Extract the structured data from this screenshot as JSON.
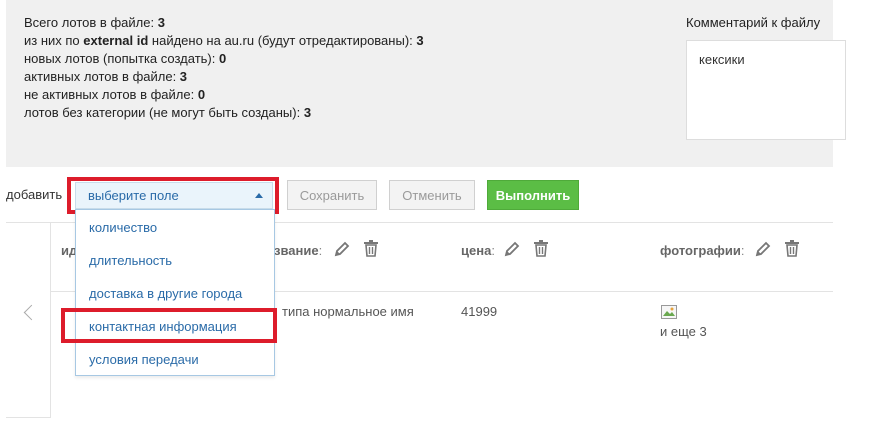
{
  "stats": {
    "total_label": "Всего лотов в файле: ",
    "total_value": "3",
    "found_prefix": "из них по ",
    "found_bold": "external id",
    "found_suffix": " найдено на au.ru (будут отредактированы): ",
    "found_value": "3",
    "new_label": "новых лотов (попытка создать): ",
    "new_value": "0",
    "active_label": "активных лотов в файле: ",
    "active_value": "3",
    "inactive_label": "не активных лотов в файле: ",
    "inactive_value": "0",
    "nocat_label": "лотов без категории (не могут быть созданы): ",
    "nocat_value": "3"
  },
  "comment": {
    "label": "Комментарий к файлу",
    "value": "кексики"
  },
  "toolbar": {
    "add_label": "добавить",
    "select_value": "выберите поле",
    "save_label": "Сохранить",
    "cancel_label": "Отменить",
    "run_label": "Выполнить"
  },
  "dropdown": {
    "options": [
      "количество",
      "длительность",
      "доставка в другие города",
      "контактная информация",
      "условия передачи"
    ],
    "highlighted_option": "контактная информация"
  },
  "columns": {
    "id_label": "ид",
    "name_label": "звание",
    "price_label": "цена",
    "photos_label": "фотографии",
    "colon": ":"
  },
  "row": {
    "name_fragment": "типа нормальное имя",
    "price": "41999",
    "photos_more": "и еще 3"
  },
  "colors": {
    "highlight": "#dd1c2b",
    "accent_blue": "#2a6ba8",
    "run_green": "#5bbd45",
    "panel_bg": "#f0f0f0"
  },
  "icons": [
    "pencil-icon",
    "trash-icon",
    "chevron-left-icon",
    "caret-up-icon",
    "broken-image-icon"
  ]
}
